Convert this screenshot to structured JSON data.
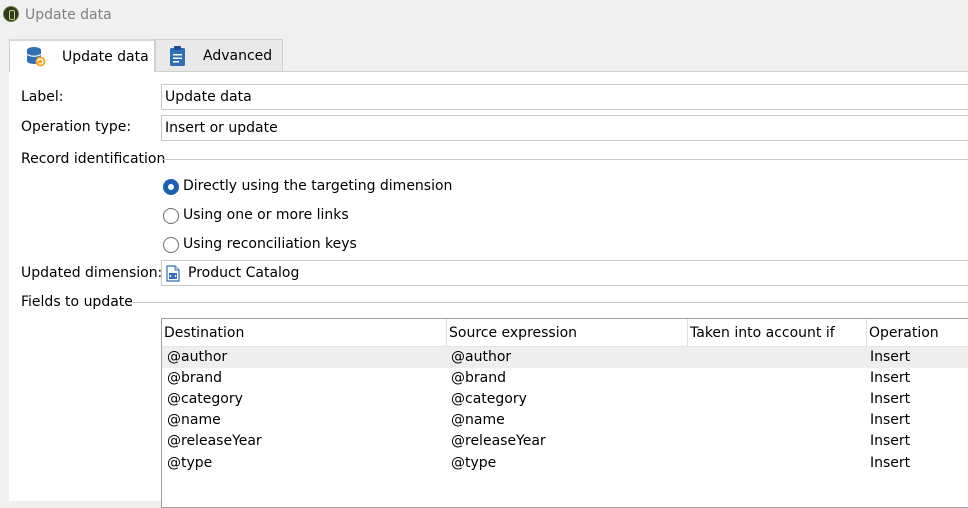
{
  "window": {
    "title": "Update data"
  },
  "tabs": [
    {
      "label": "Update data",
      "icon": "database-refresh-icon",
      "active": true
    },
    {
      "label": "Advanced",
      "icon": "clipboard-icon",
      "active": false
    }
  ],
  "form": {
    "label_caption": "Label:",
    "label_value": "Update data",
    "operation_caption": "Operation type:",
    "operation_value": "Insert or update",
    "record_identification_caption": "Record identification",
    "radio_options": [
      {
        "label": "Directly using the targeting dimension",
        "selected": true
      },
      {
        "label": "Using one or more links",
        "selected": false
      },
      {
        "label": "Using reconciliation keys",
        "selected": false
      }
    ],
    "dimension_caption": "Updated dimension:",
    "dimension_value": "Product Catalog",
    "dimension_icon": "schema-file-icon",
    "fields_caption": "Fields to update"
  },
  "fields_table": {
    "columns": [
      "Destination",
      "Source expression",
      "Taken into account if",
      "Operation"
    ],
    "rows": [
      {
        "destination": "@author",
        "source": "@author",
        "condition": "",
        "operation": "Insert"
      },
      {
        "destination": "@brand",
        "source": "@brand",
        "condition": "",
        "operation": "Insert"
      },
      {
        "destination": "@category",
        "source": "@category",
        "condition": "",
        "operation": "Insert"
      },
      {
        "destination": "@name",
        "source": "@name",
        "condition": "",
        "operation": "Insert"
      },
      {
        "destination": "@releaseYear",
        "source": "@releaseYear",
        "condition": "",
        "operation": "Insert"
      },
      {
        "destination": "@type",
        "source": "@type",
        "condition": "",
        "operation": "Insert"
      }
    ]
  },
  "colors": {
    "accent": "#1a5fb4",
    "selected_row": "#eeeeee",
    "background": "#f0f0f0"
  }
}
